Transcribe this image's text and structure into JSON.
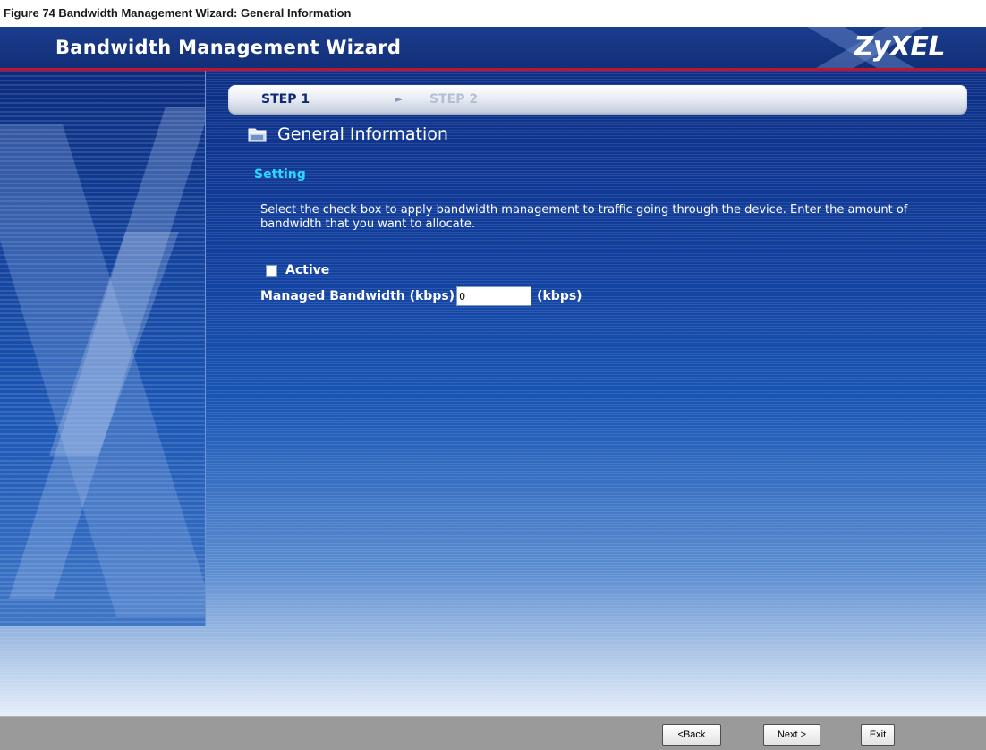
{
  "caption": "Figure 74 Bandwidth Management Wizard: General Information",
  "header": {
    "title": "Bandwidth Management Wizard",
    "logo_text": "ZyXEL"
  },
  "steps": {
    "step1": "STEP 1",
    "arrow": "►",
    "step2": "STEP 2",
    "active_step": 1
  },
  "section": {
    "icon": "folder-icon",
    "title": "General Information",
    "heading": "Setting",
    "description": "Select the check box to apply bandwidth management to traffic going through the device. Enter the amount of bandwidth that you want to allocate."
  },
  "form": {
    "active_label": "Active",
    "active_checked": false,
    "bandwidth_label": "Managed Bandwidth (kbps)",
    "bandwidth_value": "0",
    "bandwidth_unit": "(kbps)"
  },
  "footer": {
    "back_label": "<Back",
    "next_label": "Next >",
    "exit_label": "Exit"
  },
  "colors": {
    "header_blue": "#1b3d8e",
    "header_red_line": "#c3112e",
    "heading_cyan": "#29d8ff",
    "footer_gray": "#9a9a9a"
  }
}
